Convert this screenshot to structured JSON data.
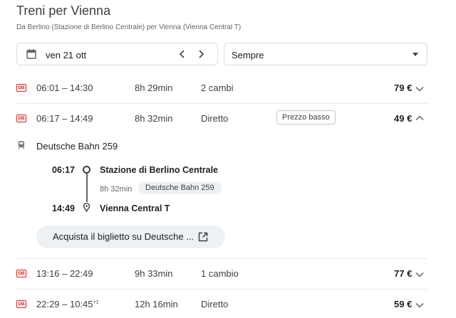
{
  "header": {
    "title": "Treni per Vienna",
    "subtitle": "Da Berlino (Stazione di Berlino Centrale) per Vienna (Vienna Central T)"
  },
  "filters": {
    "date": "ven 21 ott",
    "time": "Sempre"
  },
  "operator_badge": "DB",
  "trips": [
    {
      "times": "06:01 – 14:30",
      "day_offset": "",
      "duration": "8h 29min",
      "changes": "2 cambi",
      "price": "79 €",
      "expanded": false
    },
    {
      "times": "06:17 – 14:49",
      "day_offset": "",
      "duration": "8h 32min",
      "changes": "Diretto",
      "badge": "Prezzo basso",
      "price": "49 €",
      "expanded": true
    },
    {
      "times": "13:16 – 22:49",
      "day_offset": "",
      "duration": "9h 33min",
      "changes": "1 cambio",
      "price": "77 €",
      "expanded": false
    },
    {
      "times": "22:29 – 10:45",
      "day_offset": "+1",
      "duration": "12h 16min",
      "changes": "Diretto",
      "price": "59 €",
      "expanded": false
    }
  ],
  "details": {
    "operator": "Deutsche Bahn 259",
    "departure_time": "06:17",
    "departure_station": "Stazione di Berlino Centrale",
    "segment_duration": "8h 32min",
    "segment_train": "Deutsche Bahn 259",
    "arrival_time": "14:49",
    "arrival_station": "Vienna Central T",
    "buy_label": "Acquista il biglietto su Deutsche ..."
  },
  "icons": {
    "calendar": "calendar-icon",
    "prev": "chevron-left-icon",
    "next": "chevron-right-icon",
    "dropdown": "dropdown-arrow-icon",
    "expand": "chevron-down-icon",
    "collapse": "chevron-up-icon",
    "train": "train-icon",
    "external": "open-external-icon"
  },
  "colors": {
    "db_red": "#e0201b",
    "chip_bg": "#eef1f4",
    "divider": "#e8eaed"
  }
}
